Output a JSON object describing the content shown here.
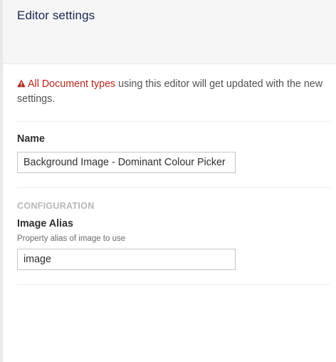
{
  "header": {
    "title": "Editor settings"
  },
  "warning": {
    "icon": "alert-triangle-icon",
    "icon_color": "#b5261e",
    "highlight": "All Document types",
    "text": " using this editor will get updated with the new settings."
  },
  "name_field": {
    "label": "Name",
    "value": "Background Image - Dominant Colour Picker"
  },
  "configuration": {
    "group_title": "CONFIGURATION",
    "image_alias": {
      "label": "Image Alias",
      "description": "Property alias of image to use",
      "value": "image"
    }
  }
}
